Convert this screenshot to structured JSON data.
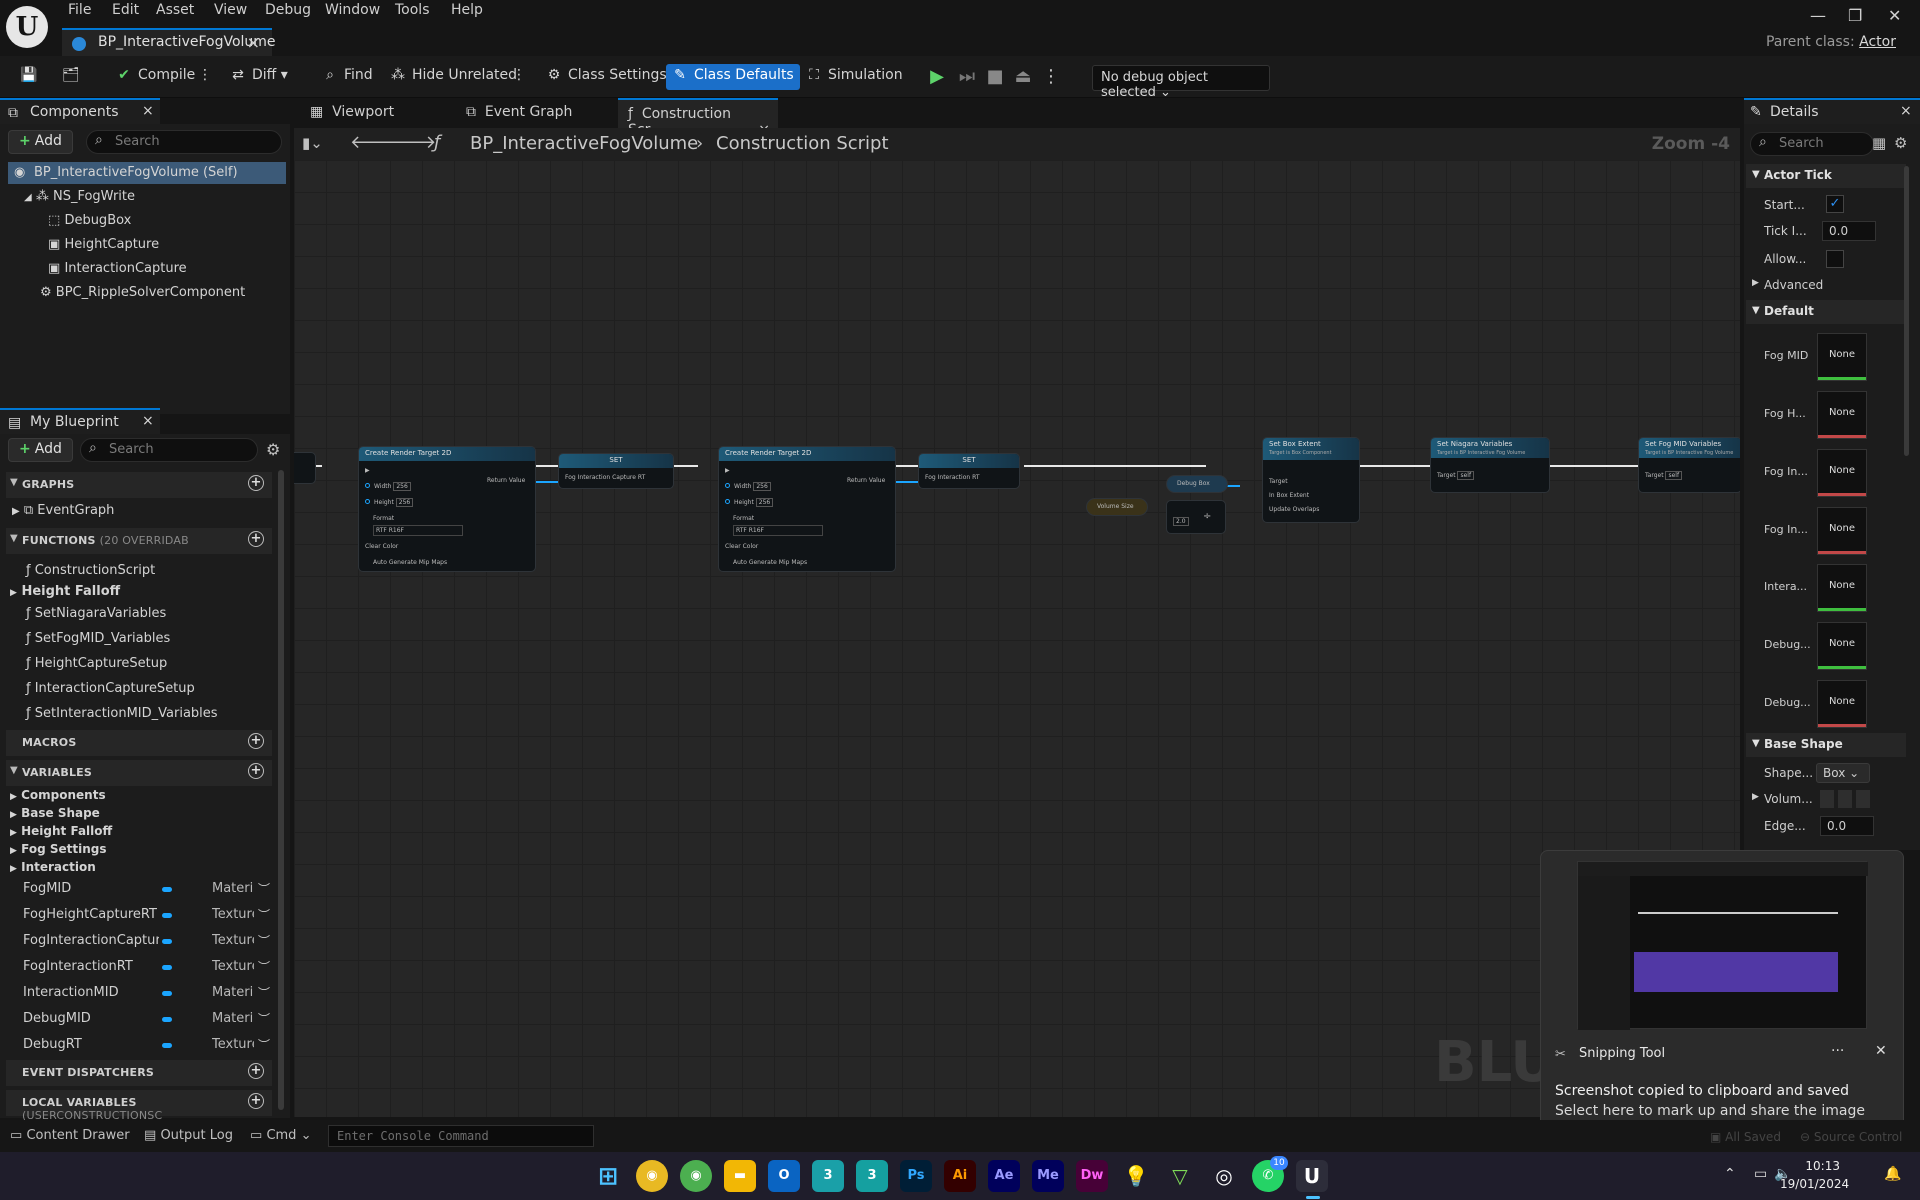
{
  "app": {
    "menu": [
      "File",
      "Edit",
      "Asset",
      "View",
      "Debug",
      "Window",
      "Tools",
      "Help"
    ],
    "document_tab": "BP_InteractiveFogVolume",
    "parent_class_label": "Parent class:",
    "parent_class_value": "Actor"
  },
  "toolbar": {
    "compile": "Compile",
    "diff": "Diff",
    "find": "Find",
    "hide_unrelated": "Hide Unrelated",
    "class_settings": "Class Settings",
    "class_defaults": "Class Defaults",
    "simulation": "Simulation",
    "debug_object": "No debug object selected"
  },
  "components": {
    "title": "Components",
    "add": "Add",
    "search_placeholder": "Search",
    "tree": [
      "BP_InteractiveFogVolume (Self)",
      "NS_FogWrite",
      "DebugBox",
      "HeightCapture",
      "InteractionCapture",
      "BPC_RippleSolverComponent"
    ]
  },
  "my_blueprint": {
    "title": "My Blueprint",
    "add": "Add",
    "search_placeholder": "Search",
    "graphs_header": "GRAPHS",
    "graphs": [
      "EventGraph"
    ],
    "functions_header": "FUNCTIONS",
    "functions_note": "(20 OVERRIDAB",
    "functions": [
      "ConstructionScript",
      "Height Falloff",
      "SetNiagaraVariables",
      "SetFogMID_Variables",
      "HeightCaptureSetup",
      "InteractionCaptureSetup",
      "SetInteractionMID_Variables"
    ],
    "macros_header": "MACROS",
    "variables_header": "VARIABLES",
    "variable_groups": [
      "Components",
      "Base Shape",
      "Height Falloff",
      "Fog Settings",
      "Interaction"
    ],
    "variables": [
      {
        "name": "FogMID",
        "type": "Material Ins"
      },
      {
        "name": "FogHeightCaptureRT",
        "type": "Texture Rer"
      },
      {
        "name": "FogInteractionCaptureI",
        "type": "Texture Rer"
      },
      {
        "name": "FogInteractionRT",
        "type": "Texture Rer"
      },
      {
        "name": "InteractionMID",
        "type": "Material Ins"
      },
      {
        "name": "DebugMID",
        "type": "Material Ins"
      },
      {
        "name": "DebugRT",
        "type": "Texture Rer"
      }
    ],
    "event_dispatchers_header": "EVENT DISPATCHERS",
    "local_variables_header": "LOCAL VARIABLES",
    "local_variables_note": "(USERCONSTRUCTIONSC"
  },
  "editor_tabs": [
    "Viewport",
    "Event Graph",
    "Construction Scr..."
  ],
  "breadcrumb": {
    "blueprint": "BP_InteractiveFogVolume",
    "graph": "Construction Script",
    "zoom": "Zoom -4"
  },
  "nodes": {
    "create_rt_1": {
      "title": "Create Render Target 2D",
      "width": "256",
      "height": "256",
      "format": "RTF R16F",
      "return": "Return Value",
      "clear": "Clear Color",
      "mips": "Auto Generate Mip Maps",
      "width_label": "Width",
      "height_label": "Height",
      "format_label": "Format"
    },
    "set_1": {
      "title": "SET",
      "pin": "Fog Interaction Capture RT"
    },
    "create_rt_2": {
      "title": "Create Render Target 2D",
      "width": "256",
      "height": "256",
      "format": "RTF R16F",
      "return": "Return Value",
      "clear": "Clear Color",
      "mips": "Auto Generate Mip Maps",
      "width_label": "Width",
      "height_label": "Height",
      "format_label": "Format"
    },
    "set_2": {
      "title": "SET",
      "pin": "Fog Interaction RT"
    },
    "debug_box": "Debug Box",
    "volume_size": "Volume Size",
    "divide_value": "2.0",
    "set_box_extent": {
      "title": "Set Box Extent",
      "sub": "Target is Box Component",
      "target": "Target",
      "in_box": "In Box Extent",
      "update": "Update Overlaps"
    },
    "set_niagara": {
      "title": "Set Niagara Variables",
      "sub": "Target is BP Interactive Fog Volume",
      "target": "Target",
      "self": "self"
    },
    "set_fog_mid": {
      "title": "Set Fog MID Variables",
      "sub": "Target is BP Interactive Fog Volume",
      "target": "Target",
      "self": "self"
    },
    "watermark": "BLU"
  },
  "details": {
    "title": "Details",
    "search_placeholder": "Search",
    "actor_tick": "Actor Tick",
    "start_label": "Start...",
    "tick_label": "Tick I...",
    "tick_value": "0.0",
    "allow_label": "Allow...",
    "advanced": "Advanced",
    "default": "Default",
    "asset_rows": [
      {
        "label": "Fog MID",
        "value": "None",
        "color": "#3fbf3f"
      },
      {
        "label": "Fog H...",
        "value": "None",
        "color": "#c24848"
      },
      {
        "label": "Fog In...",
        "value": "None",
        "color": "#c24848"
      },
      {
        "label": "Fog In...",
        "value": "None",
        "color": "#c24848"
      },
      {
        "label": "Intera...",
        "value": "None",
        "color": "#3fbf3f"
      },
      {
        "label": "Debug...",
        "value": "None",
        "color": "#3fbf3f"
      },
      {
        "label": "Debug...",
        "value": "None",
        "color": "#c24848"
      }
    ],
    "base_shape": "Base Shape",
    "shape_label": "Shape...",
    "shape_value": "Box",
    "volume_label": "Volum...",
    "edge_label": "Edge...",
    "edge_value": "0.0"
  },
  "toast": {
    "app": "Snipping Tool",
    "line1": "Screenshot copied to clipboard and saved",
    "line2": "Select here to mark up and share the image"
  },
  "bottom": {
    "content_drawer": "Content Drawer",
    "output_log": "Output Log",
    "cmd": "Cmd",
    "console_placeholder": "Enter Console Command",
    "all_saved": "All Saved",
    "source_control": "Source Control"
  },
  "taskbar": {
    "time": "10:13",
    "date": "19/01/2024",
    "whatsapp_badge": "10",
    "apps": [
      "Ps",
      "Ai",
      "Ae",
      "Me",
      "Dw"
    ]
  }
}
